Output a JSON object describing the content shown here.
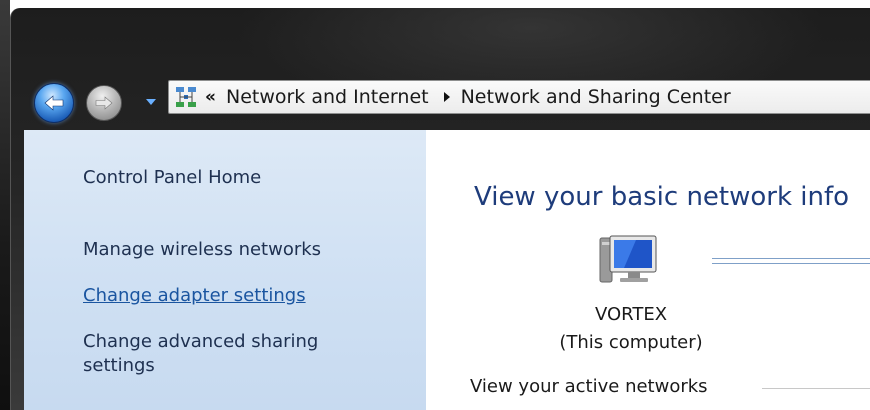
{
  "navigation": {
    "breadcrumb": [
      "Network and Internet",
      "Network and Sharing Center"
    ]
  },
  "left_pane": {
    "items": [
      {
        "label": "Control Panel Home"
      },
      {
        "label": "Manage wireless networks"
      },
      {
        "label": "Change adapter settings"
      },
      {
        "label": "Change advanced sharing settings"
      }
    ]
  },
  "main": {
    "title": "View your basic network info",
    "computer_name": "VORTEX",
    "computer_subtitle": "(This computer)",
    "active_networks_label": "View your active networks"
  },
  "colors": {
    "title": "#1e3c7b",
    "link": "#1a55a0",
    "pane_bg": "#d6e5f5"
  }
}
